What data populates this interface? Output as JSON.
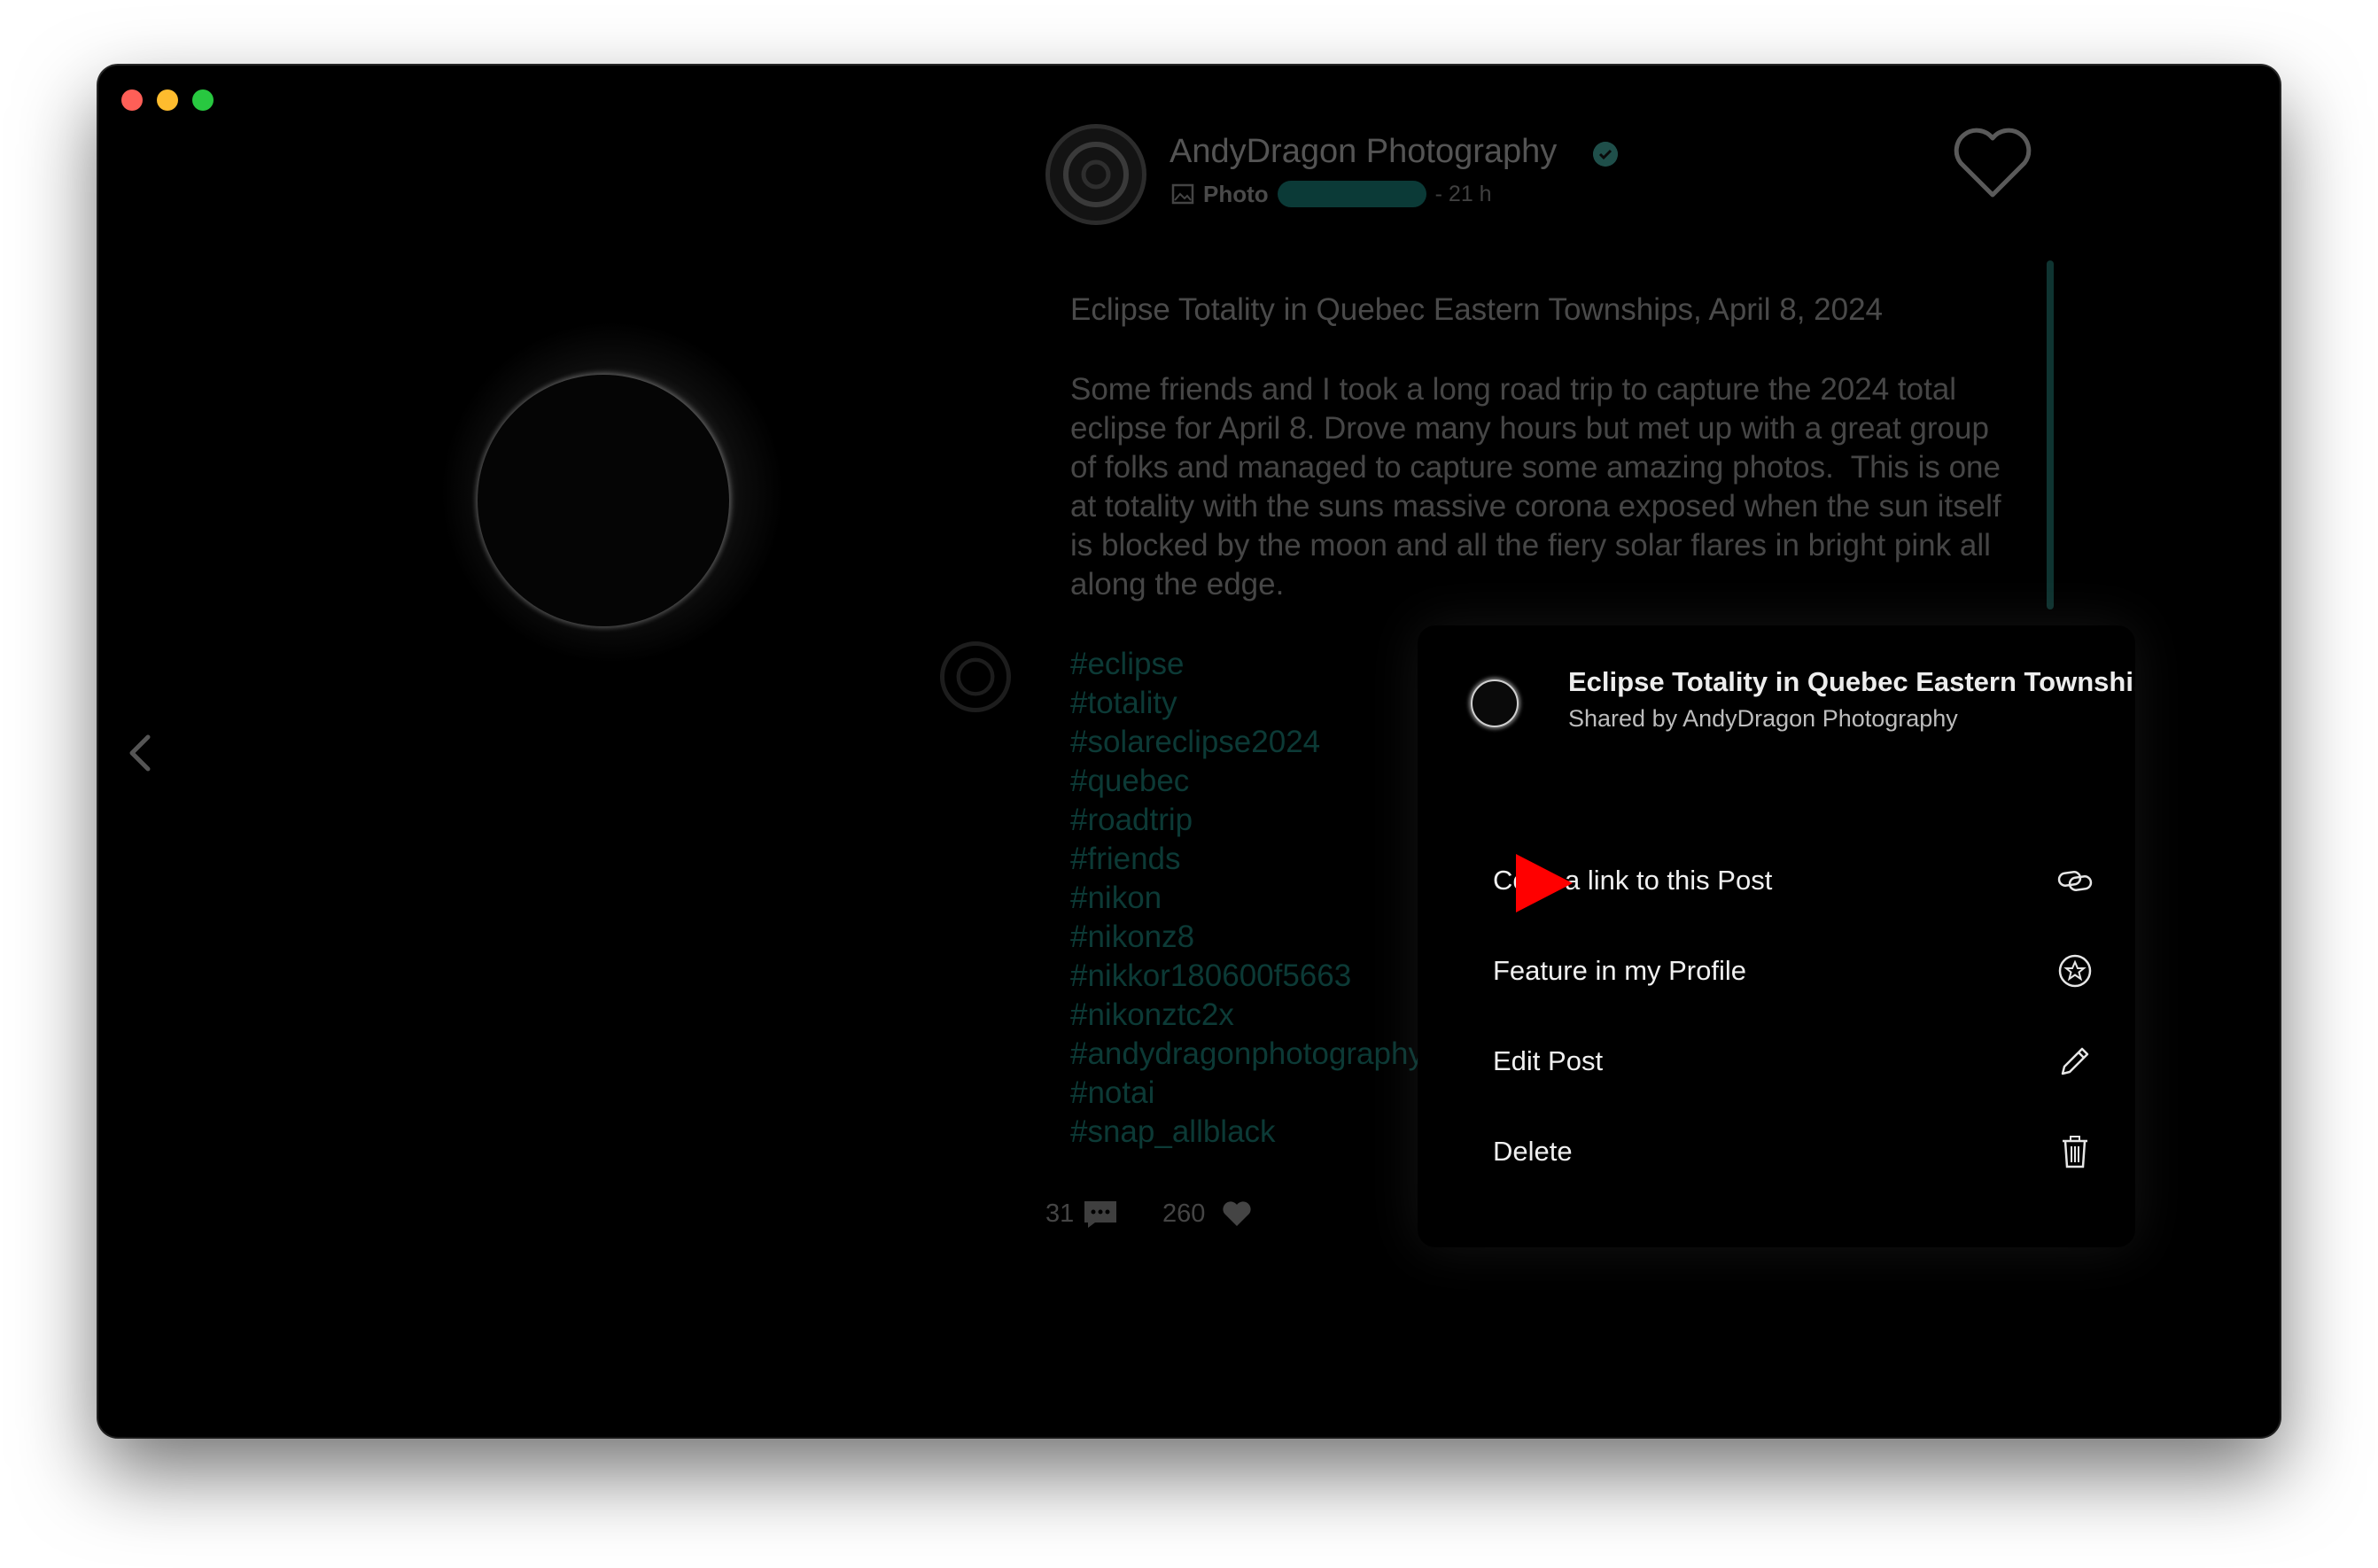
{
  "post": {
    "author_name": "AndyDragon Photography",
    "type_label": "Photo",
    "time_ago": "- 21 h",
    "title": "Eclipse Totality in Quebec Eastern Townships, April 8, 2024",
    "body": "Some friends and I took a long road trip to capture the 2024 total eclipse for April 8. Drove many hours but met up with a great group of folks and managed to capture some amazing photos.  This is one at totality with the suns massive corona exposed when the sun itself is blocked by the moon and all the fiery solar flares in bright pink all along the edge.",
    "hashtags": [
      "#eclipse",
      "#totality",
      "#solareclipse2024",
      "#quebec",
      "#roadtrip",
      "#friends",
      "#nikon",
      "#nikonz8",
      "#nikkor180600f5663",
      "#nikonztc2x",
      "#andydragonphotography",
      "#notai",
      "#snap_allblack"
    ],
    "comments_count": "31",
    "likes_count": "260"
  },
  "menu": {
    "header_title": "Eclipse Totality in Quebec Eastern Townshi...",
    "header_subtitle": "Shared by AndyDragon Photography",
    "items": [
      {
        "label": "Copy a link to this Post",
        "icon": "link-icon"
      },
      {
        "label": "Feature in my Profile",
        "icon": "star-badge-icon"
      },
      {
        "label": "Edit Post",
        "icon": "pencil-icon"
      },
      {
        "label": "Delete",
        "icon": "trash-icon"
      }
    ]
  },
  "icons": {
    "nav_prev": "chevron-left-icon",
    "favorite": "heart-outline-icon",
    "verified": "verified-badge-icon",
    "share": "paper-plane-icon",
    "bookmark": "bookmark-icon",
    "more": "ellipsis-icon",
    "pointer": "red-arrow-icon"
  },
  "colors": {
    "accent_teal": "#0c3a36",
    "pointer_red": "#ff0000",
    "window_bg": "#000000"
  }
}
